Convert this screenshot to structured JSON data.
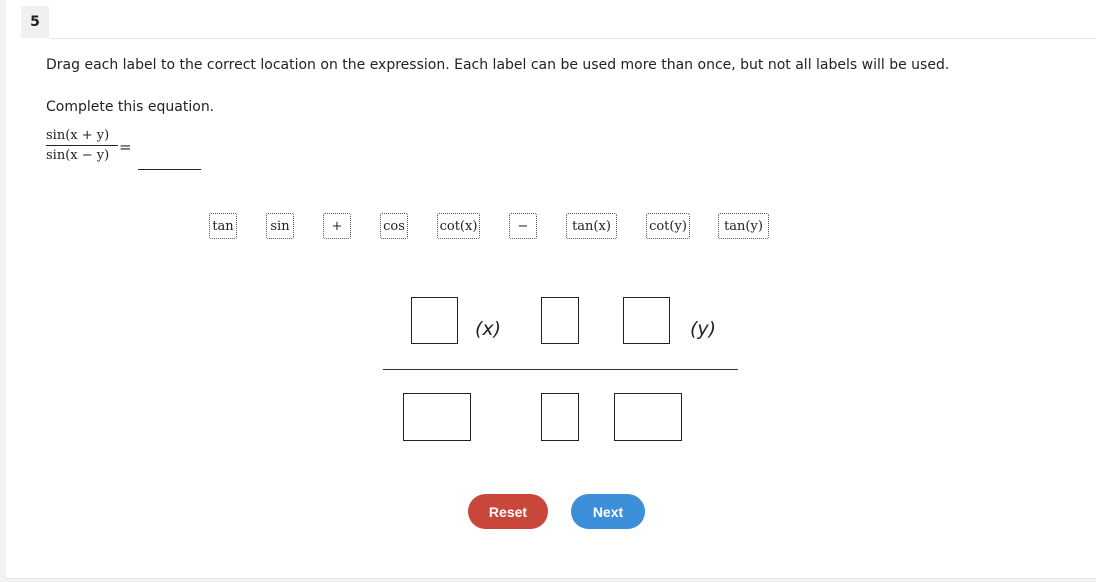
{
  "question": {
    "number": "5",
    "instruction": "Drag each label to the correct location on the expression. Each label can be used more than once, but not all labels will be used.",
    "prompt": "Complete this equation.",
    "fraction_numerator": "sin(x + y)",
    "fraction_denominator": "sin(x − y)",
    "equals": "="
  },
  "labels": [
    {
      "id": "tan",
      "text": "tan"
    },
    {
      "id": "sin",
      "text": "sin"
    },
    {
      "id": "plus",
      "text": "+"
    },
    {
      "id": "cos",
      "text": "cos"
    },
    {
      "id": "cotx",
      "text": "cot(x)"
    },
    {
      "id": "minus",
      "text": "−"
    },
    {
      "id": "tanx",
      "text": "tan(x)"
    },
    {
      "id": "coty",
      "text": "cot(y)"
    },
    {
      "id": "tany",
      "text": "tan(y)"
    }
  ],
  "expression": {
    "numerator_var_x": "(x)",
    "numerator_var_y": "(y)"
  },
  "buttons": {
    "reset": "Reset",
    "next": "Next"
  }
}
